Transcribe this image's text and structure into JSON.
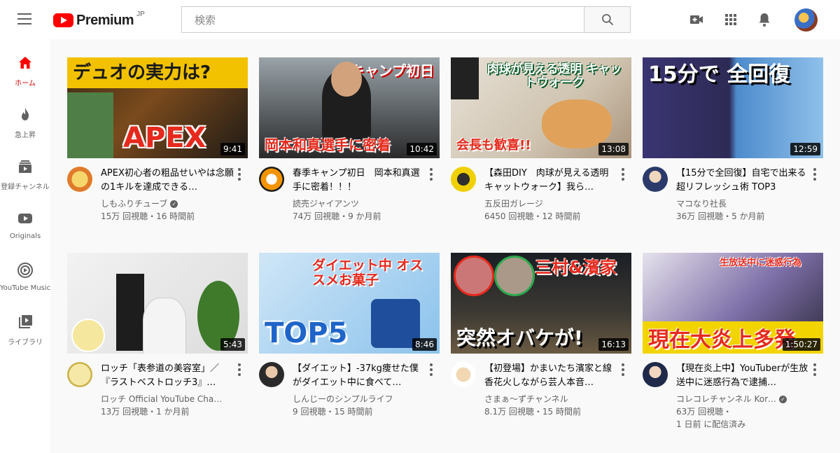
{
  "header": {
    "brand": "Premium",
    "region": "JP",
    "search_placeholder": "検索"
  },
  "sidebar": {
    "items": [
      {
        "label": "ホーム",
        "icon": "home-icon",
        "active": true
      },
      {
        "label": "急上昇",
        "icon": "flame-icon",
        "active": false
      },
      {
        "label": "登録チャンネル",
        "icon": "subscriptions-icon",
        "active": false
      },
      {
        "label": "Originals",
        "icon": "originals-icon",
        "active": false
      },
      {
        "label": "YouTube Music",
        "icon": "music-icon",
        "active": false
      },
      {
        "label": "ライブラリ",
        "icon": "library-icon",
        "active": false
      }
    ]
  },
  "colors": {
    "brand_red": "#ff0000",
    "active_red": "#cc0000",
    "text_secondary": "#606060"
  },
  "videos": [
    {
      "title": "APEX初心者の粗品せいやは念願の1キルを達成できる…",
      "channel": "しもふりチューブ",
      "verified": true,
      "stats": "15万 回視聴・16 時間前",
      "duration": "9:41",
      "thumb_top": "デュオの実力は?",
      "thumb_bottom": "APEX"
    },
    {
      "title": "春季キャンプ初日　岡本和真選手に密着！！！",
      "channel": "読売ジャイアンツ",
      "verified": false,
      "stats": "74万 回視聴・9 か月前",
      "duration": "10:42",
      "thumb_top": "キャンプ初日",
      "thumb_bottom": "岡本和真選手に密着"
    },
    {
      "title": "【森田DIY　肉球が見える透明キャットウォーク】我ら…",
      "channel": "五反田ガレージ",
      "verified": false,
      "stats": "6450 回視聴・12 時間前",
      "duration": "13:08",
      "thumb_top": "肉球が見える透明 キャットウォーク",
      "thumb_bottom": "会長も歓喜!!"
    },
    {
      "title": "【15分で全回復】自宅で出来る超リフレッシュ術 TOP3",
      "channel": "マコなり社長",
      "verified": false,
      "stats": "36万 回視聴・5 か月前",
      "duration": "12:59",
      "thumb_top": "15分で 全回復",
      "thumb_bottom": ""
    },
    {
      "title": "ロッチ「表参道の美容室」／『ラストベストロッチ3』…",
      "channel": "ロッチ Official YouTube Cha…",
      "verified": false,
      "stats": "13万 回視聴・1 か月前",
      "duration": "5:43",
      "thumb_top": "",
      "thumb_bottom": ""
    },
    {
      "title": "【ダイエット】-37kg痩せた僕がダイエット中に食べて…",
      "channel": "しんじーのシンプルライフ",
      "verified": false,
      "stats": "9 回視聴・15 時間前",
      "duration": "8:46",
      "thumb_top": "ダイエット中 オススメお菓子",
      "thumb_bottom": "TOP5"
    },
    {
      "title": "【初登場】かまいたち濱家と線香花火しながら芸人本音…",
      "channel": "さまぁ～ずチャンネル",
      "verified": false,
      "stats": "8.1万 回視聴・15 時間前",
      "duration": "16:13",
      "thumb_top": "三村&濱家",
      "thumb_bottom": "突然オバケが!"
    },
    {
      "title": "【現在炎上中】YouTuberが生放送中に迷惑行為で逮捕…",
      "channel": "コレコレチャンネル Kor…",
      "verified": true,
      "stats": "63万 回視聴・",
      "stats2": "1 日前 に配信済み",
      "duration": "1:50:27",
      "thumb_top": "生放送中に迷惑行為",
      "thumb_bottom": "現在大炎上多発"
    }
  ]
}
